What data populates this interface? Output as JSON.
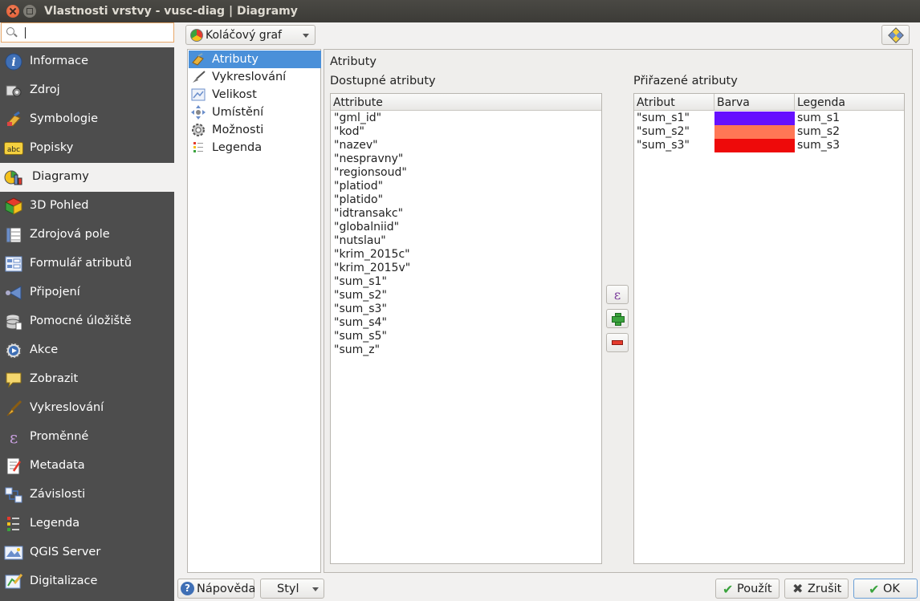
{
  "window": {
    "title": "Vlastnosti vrstvy - vusc-diag | Diagramy"
  },
  "sidebar": {
    "search_value": "",
    "items": [
      {
        "label": "Informace",
        "icon": "info-icon",
        "active": false
      },
      {
        "label": "Zdroj",
        "icon": "source-icon",
        "active": false
      },
      {
        "label": "Symbologie",
        "icon": "symbology-icon",
        "active": false
      },
      {
        "label": "Popisky",
        "icon": "labels-icon",
        "active": false
      },
      {
        "label": "Diagramy",
        "icon": "diagram-icon",
        "active": true
      },
      {
        "label": "3D Pohled",
        "icon": "3d-cube-icon",
        "active": false
      },
      {
        "label": "Zdrojová pole",
        "icon": "source-fields-icon",
        "active": false
      },
      {
        "label": "Formulář atributů",
        "icon": "attribute-form-icon",
        "active": false
      },
      {
        "label": "Připojení",
        "icon": "join-icon",
        "active": false
      },
      {
        "label": "Pomocné úložiště",
        "icon": "auxiliary-storage-icon",
        "active": false
      },
      {
        "label": "Akce",
        "icon": "action-icon",
        "active": false
      },
      {
        "label": "Zobrazit",
        "icon": "display-icon",
        "active": false
      },
      {
        "label": "Vykreslování",
        "icon": "rendering-icon",
        "active": false
      },
      {
        "label": "Proměnné",
        "icon": "variables-icon",
        "active": false
      },
      {
        "label": "Metadata",
        "icon": "metadata-icon",
        "active": false
      },
      {
        "label": "Závislosti",
        "icon": "dependencies-icon",
        "active": false
      },
      {
        "label": "Legenda",
        "icon": "legend-icon",
        "active": false
      },
      {
        "label": "QGIS Server",
        "icon": "qgis-server-icon",
        "active": false
      },
      {
        "label": "Digitalizace",
        "icon": "digitizing-icon",
        "active": false
      }
    ]
  },
  "toolbar": {
    "diagram_type": "Koláčový graf",
    "diagram_type_icon": "pie-chart-icon",
    "right_button_icon": "styling-icon"
  },
  "subsections": [
    {
      "label": "Atributy",
      "icon": "attributes-icon",
      "active": true
    },
    {
      "label": "Vykreslování",
      "icon": "brush-icon",
      "active": false
    },
    {
      "label": "Velikost",
      "icon": "size-icon",
      "active": false
    },
    {
      "label": "Umístění",
      "icon": "placement-icon",
      "active": false
    },
    {
      "label": "Možnosti",
      "icon": "options-icon",
      "active": false
    },
    {
      "label": "Legenda",
      "icon": "legend-icon",
      "active": false
    }
  ],
  "panel": {
    "title": "Atributy",
    "available_label": "Dostupné atributy",
    "assigned_label": "Přiřazené atributy",
    "available_header": "Attribute",
    "available": [
      "\"gml_id\"",
      "\"kod\"",
      "\"nazev\"",
      "\"nespravny\"",
      "\"regionsoud\"",
      "\"platiod\"",
      "\"platido\"",
      "\"idtransakc\"",
      "\"globalniid\"",
      "\"nutslau\"",
      "\"krim_2015c\"",
      "\"krim_2015v\"",
      "\"sum_s1\"",
      "\"sum_s2\"",
      "\"sum_s3\"",
      "\"sum_s4\"",
      "\"sum_s5\"",
      "\"sum_z\""
    ],
    "assigned_headers": [
      "Atribut",
      "Barva",
      "Legenda"
    ],
    "assigned": [
      {
        "attribute": "\"sum_s1\"",
        "color": "#6610ff",
        "legend": "sum_s1"
      },
      {
        "attribute": "\"sum_s2\"",
        "color": "#ff7755",
        "legend": "sum_s2"
      },
      {
        "attribute": "\"sum_s3\"",
        "color": "#ee0a0a",
        "legend": "sum_s3"
      }
    ],
    "expression_button_glyph": "ε"
  },
  "footer": {
    "help": "Nápověda",
    "style": "Styl",
    "apply": "Použít",
    "cancel": "Zrušit",
    "ok": "OK"
  }
}
